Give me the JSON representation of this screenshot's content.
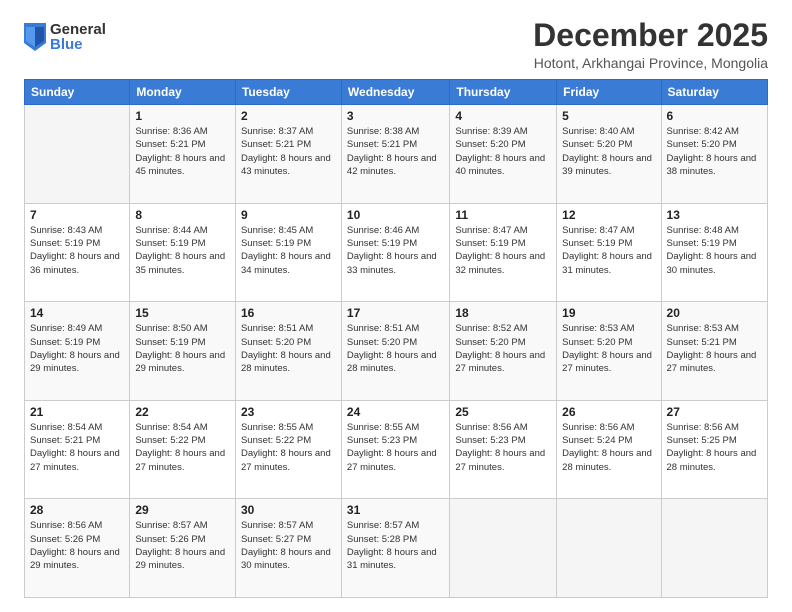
{
  "logo": {
    "general": "General",
    "blue": "Blue"
  },
  "title": "December 2025",
  "subtitle": "Hotont, Arkhangai Province, Mongolia",
  "days_header": [
    "Sunday",
    "Monday",
    "Tuesday",
    "Wednesday",
    "Thursday",
    "Friday",
    "Saturday"
  ],
  "weeks": [
    [
      {
        "day": "",
        "sunrise": "",
        "sunset": "",
        "daylight": ""
      },
      {
        "day": "1",
        "sunrise": "Sunrise: 8:36 AM",
        "sunset": "Sunset: 5:21 PM",
        "daylight": "Daylight: 8 hours and 45 minutes."
      },
      {
        "day": "2",
        "sunrise": "Sunrise: 8:37 AM",
        "sunset": "Sunset: 5:21 PM",
        "daylight": "Daylight: 8 hours and 43 minutes."
      },
      {
        "day": "3",
        "sunrise": "Sunrise: 8:38 AM",
        "sunset": "Sunset: 5:21 PM",
        "daylight": "Daylight: 8 hours and 42 minutes."
      },
      {
        "day": "4",
        "sunrise": "Sunrise: 8:39 AM",
        "sunset": "Sunset: 5:20 PM",
        "daylight": "Daylight: 8 hours and 40 minutes."
      },
      {
        "day": "5",
        "sunrise": "Sunrise: 8:40 AM",
        "sunset": "Sunset: 5:20 PM",
        "daylight": "Daylight: 8 hours and 39 minutes."
      },
      {
        "day": "6",
        "sunrise": "Sunrise: 8:42 AM",
        "sunset": "Sunset: 5:20 PM",
        "daylight": "Daylight: 8 hours and 38 minutes."
      }
    ],
    [
      {
        "day": "7",
        "sunrise": "Sunrise: 8:43 AM",
        "sunset": "Sunset: 5:19 PM",
        "daylight": "Daylight: 8 hours and 36 minutes."
      },
      {
        "day": "8",
        "sunrise": "Sunrise: 8:44 AM",
        "sunset": "Sunset: 5:19 PM",
        "daylight": "Daylight: 8 hours and 35 minutes."
      },
      {
        "day": "9",
        "sunrise": "Sunrise: 8:45 AM",
        "sunset": "Sunset: 5:19 PM",
        "daylight": "Daylight: 8 hours and 34 minutes."
      },
      {
        "day": "10",
        "sunrise": "Sunrise: 8:46 AM",
        "sunset": "Sunset: 5:19 PM",
        "daylight": "Daylight: 8 hours and 33 minutes."
      },
      {
        "day": "11",
        "sunrise": "Sunrise: 8:47 AM",
        "sunset": "Sunset: 5:19 PM",
        "daylight": "Daylight: 8 hours and 32 minutes."
      },
      {
        "day": "12",
        "sunrise": "Sunrise: 8:47 AM",
        "sunset": "Sunset: 5:19 PM",
        "daylight": "Daylight: 8 hours and 31 minutes."
      },
      {
        "day": "13",
        "sunrise": "Sunrise: 8:48 AM",
        "sunset": "Sunset: 5:19 PM",
        "daylight": "Daylight: 8 hours and 30 minutes."
      }
    ],
    [
      {
        "day": "14",
        "sunrise": "Sunrise: 8:49 AM",
        "sunset": "Sunset: 5:19 PM",
        "daylight": "Daylight: 8 hours and 29 minutes."
      },
      {
        "day": "15",
        "sunrise": "Sunrise: 8:50 AM",
        "sunset": "Sunset: 5:19 PM",
        "daylight": "Daylight: 8 hours and 29 minutes."
      },
      {
        "day": "16",
        "sunrise": "Sunrise: 8:51 AM",
        "sunset": "Sunset: 5:20 PM",
        "daylight": "Daylight: 8 hours and 28 minutes."
      },
      {
        "day": "17",
        "sunrise": "Sunrise: 8:51 AM",
        "sunset": "Sunset: 5:20 PM",
        "daylight": "Daylight: 8 hours and 28 minutes."
      },
      {
        "day": "18",
        "sunrise": "Sunrise: 8:52 AM",
        "sunset": "Sunset: 5:20 PM",
        "daylight": "Daylight: 8 hours and 27 minutes."
      },
      {
        "day": "19",
        "sunrise": "Sunrise: 8:53 AM",
        "sunset": "Sunset: 5:20 PM",
        "daylight": "Daylight: 8 hours and 27 minutes."
      },
      {
        "day": "20",
        "sunrise": "Sunrise: 8:53 AM",
        "sunset": "Sunset: 5:21 PM",
        "daylight": "Daylight: 8 hours and 27 minutes."
      }
    ],
    [
      {
        "day": "21",
        "sunrise": "Sunrise: 8:54 AM",
        "sunset": "Sunset: 5:21 PM",
        "daylight": "Daylight: 8 hours and 27 minutes."
      },
      {
        "day": "22",
        "sunrise": "Sunrise: 8:54 AM",
        "sunset": "Sunset: 5:22 PM",
        "daylight": "Daylight: 8 hours and 27 minutes."
      },
      {
        "day": "23",
        "sunrise": "Sunrise: 8:55 AM",
        "sunset": "Sunset: 5:22 PM",
        "daylight": "Daylight: 8 hours and 27 minutes."
      },
      {
        "day": "24",
        "sunrise": "Sunrise: 8:55 AM",
        "sunset": "Sunset: 5:23 PM",
        "daylight": "Daylight: 8 hours and 27 minutes."
      },
      {
        "day": "25",
        "sunrise": "Sunrise: 8:56 AM",
        "sunset": "Sunset: 5:23 PM",
        "daylight": "Daylight: 8 hours and 27 minutes."
      },
      {
        "day": "26",
        "sunrise": "Sunrise: 8:56 AM",
        "sunset": "Sunset: 5:24 PM",
        "daylight": "Daylight: 8 hours and 28 minutes."
      },
      {
        "day": "27",
        "sunrise": "Sunrise: 8:56 AM",
        "sunset": "Sunset: 5:25 PM",
        "daylight": "Daylight: 8 hours and 28 minutes."
      }
    ],
    [
      {
        "day": "28",
        "sunrise": "Sunrise: 8:56 AM",
        "sunset": "Sunset: 5:26 PM",
        "daylight": "Daylight: 8 hours and 29 minutes."
      },
      {
        "day": "29",
        "sunrise": "Sunrise: 8:57 AM",
        "sunset": "Sunset: 5:26 PM",
        "daylight": "Daylight: 8 hours and 29 minutes."
      },
      {
        "day": "30",
        "sunrise": "Sunrise: 8:57 AM",
        "sunset": "Sunset: 5:27 PM",
        "daylight": "Daylight: 8 hours and 30 minutes."
      },
      {
        "day": "31",
        "sunrise": "Sunrise: 8:57 AM",
        "sunset": "Sunset: 5:28 PM",
        "daylight": "Daylight: 8 hours and 31 minutes."
      },
      {
        "day": "",
        "sunrise": "",
        "sunset": "",
        "daylight": ""
      },
      {
        "day": "",
        "sunrise": "",
        "sunset": "",
        "daylight": ""
      },
      {
        "day": "",
        "sunrise": "",
        "sunset": "",
        "daylight": ""
      }
    ]
  ]
}
